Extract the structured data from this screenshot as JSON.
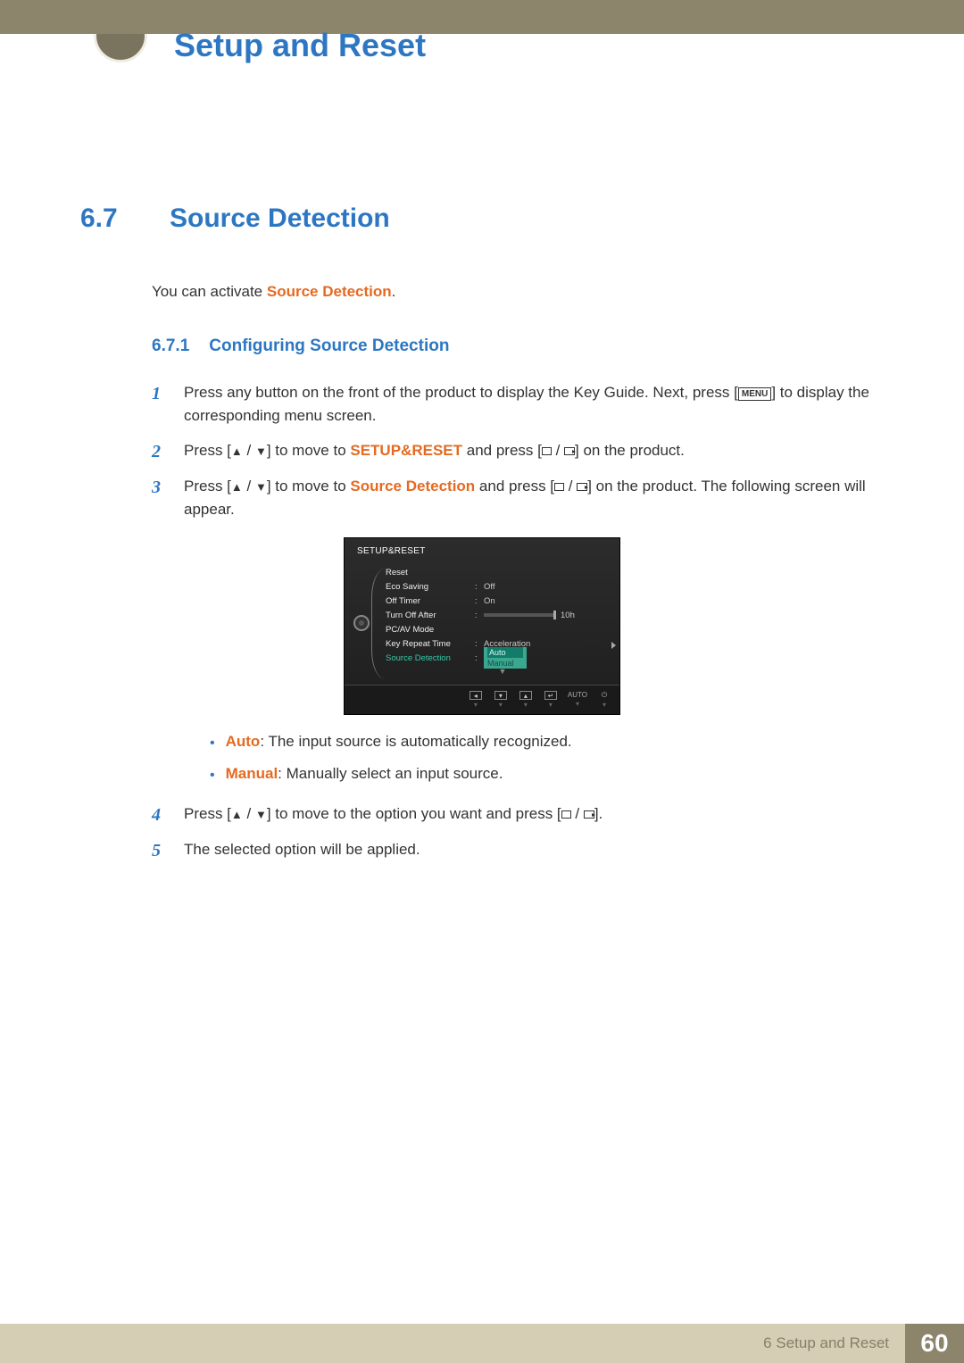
{
  "chapter_title": "Setup and Reset",
  "section": {
    "num": "6.7",
    "title": "Source Detection"
  },
  "intro": {
    "pre": "You can activate ",
    "highlight": "Source Detection",
    "post": "."
  },
  "subsection": {
    "num": "6.7.1",
    "title": "Configuring Source Detection"
  },
  "steps": {
    "s1": {
      "num": "1",
      "pre": "Press any button on the front of the product to display the Key Guide. Next, press [",
      "menu": "MENU",
      "post": "] to display the corresponding menu screen."
    },
    "s2": {
      "num": "2",
      "a": "Press [",
      "b": "] to move to ",
      "hl": "SETUP&RESET",
      "c": " and press [",
      "d": "] on the product."
    },
    "s3": {
      "num": "3",
      "a": "Press [",
      "b": "] to move to ",
      "hl": "Source Detection",
      "c": " and press [",
      "d": "] on the product. The following screen will appear."
    },
    "s4": {
      "num": "4",
      "a": "Press [",
      "b": "] to move to the option you want and press [",
      "c": "]."
    },
    "s5": {
      "num": "5",
      "text": "The selected option will be applied."
    }
  },
  "bullets": {
    "b1": {
      "hl": "Auto",
      "text": ": The input source is automatically recognized."
    },
    "b2": {
      "hl": "Manual",
      "text": ": Manually select an input source."
    }
  },
  "osd": {
    "title": "SETUP&RESET",
    "rows": {
      "reset": "Reset",
      "eco": "Eco Saving",
      "eco_val": "Off",
      "offtimer": "Off Timer",
      "offtimer_val": "On",
      "turnoff": "Turn Off After",
      "turnoff_val": "10h",
      "pcav": "PC/AV Mode",
      "keyrep": "Key Repeat Time",
      "keyrep_val": "Acceleration",
      "srcdet": "Source Detection",
      "dd_sel": "Auto",
      "dd_opt": "Manual"
    },
    "footer": {
      "auto": "AUTO"
    }
  },
  "footer": {
    "chapter": "6 Setup and Reset",
    "page": "60"
  }
}
